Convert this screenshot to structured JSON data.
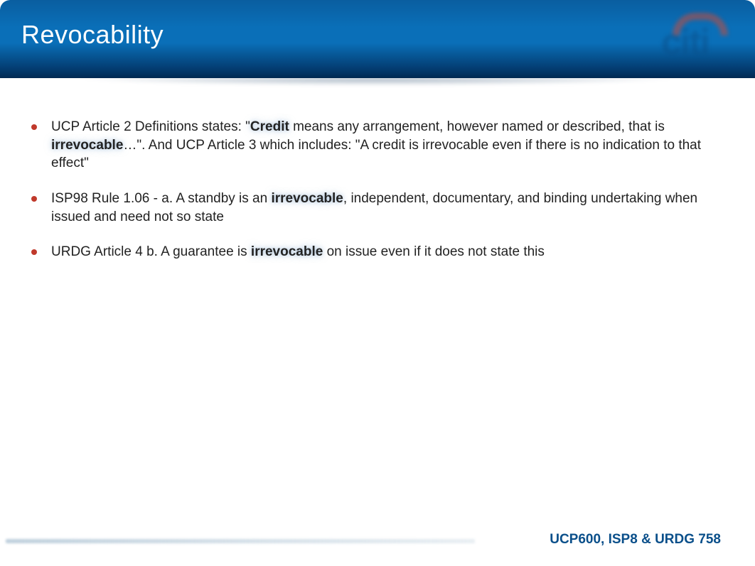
{
  "header": {
    "title": "Revocability",
    "logo_text": "citi"
  },
  "bullets": [
    {
      "pre": "UCP Article 2 Definitions states: \"",
      "bold1": "Credit",
      "mid1": " means any arrangement, however named or described, that is ",
      "bold2": "irrevocable",
      "post": "…\". And UCP Article 3 which includes: \"A credit is irrevocable even if there is no indication to that effect\""
    },
    {
      "pre": "ISP98 Rule 1.06  - a. A standby is an ",
      "bold1": "irrevocable",
      "post": ", independent, documentary, and binding undertaking when issued and need not so state"
    },
    {
      "pre": "URDG Article 4 b. A guarantee is ",
      "bold1": "irrevocable",
      "post": " on issue even if it does not state this"
    }
  ],
  "footer": {
    "label": "UCP600, ISP8 & URDG 758"
  }
}
